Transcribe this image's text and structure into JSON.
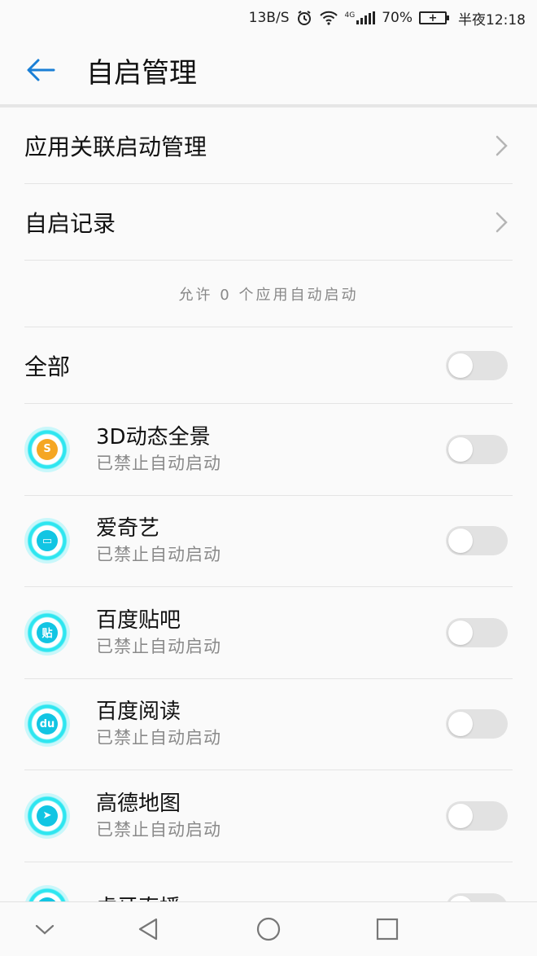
{
  "status_bar": {
    "net_speed": "13B/S",
    "net_type": "4G",
    "battery_percent": "70%",
    "time": "半夜12:18",
    "icons": [
      "alarm-icon",
      "wifi-icon",
      "signal-icon",
      "battery-icon"
    ]
  },
  "header": {
    "title": "自启管理",
    "back_icon": "back-arrow-icon",
    "accent_color": "#1a7fd6"
  },
  "menu": [
    {
      "label": "应用关联启动管理"
    },
    {
      "label": "自启记录"
    }
  ],
  "summary": "允许 0 个应用自动启动",
  "all_toggle": {
    "label": "全部",
    "on": false
  },
  "apps": [
    {
      "name": "3D动态全景",
      "status": "已禁止自动启动",
      "icon_glyph": "S",
      "on": false
    },
    {
      "name": "爱奇艺",
      "status": "已禁止自动启动",
      "icon_glyph": "▭",
      "on": false
    },
    {
      "name": "百度贴吧",
      "status": "已禁止自动启动",
      "icon_glyph": "贴",
      "on": false
    },
    {
      "name": "百度阅读",
      "status": "已禁止自动启动",
      "icon_glyph": "du",
      "on": false
    },
    {
      "name": "高德地图",
      "status": "已禁止自动启动",
      "icon_glyph": "➤",
      "on": false
    },
    {
      "name": "虎牙直播",
      "status": "",
      "icon_glyph": "",
      "on": false
    }
  ],
  "nav_bar": {
    "icons": [
      "collapse-chevron-icon",
      "back-triangle-icon",
      "home-circle-icon",
      "recents-square-icon"
    ]
  }
}
